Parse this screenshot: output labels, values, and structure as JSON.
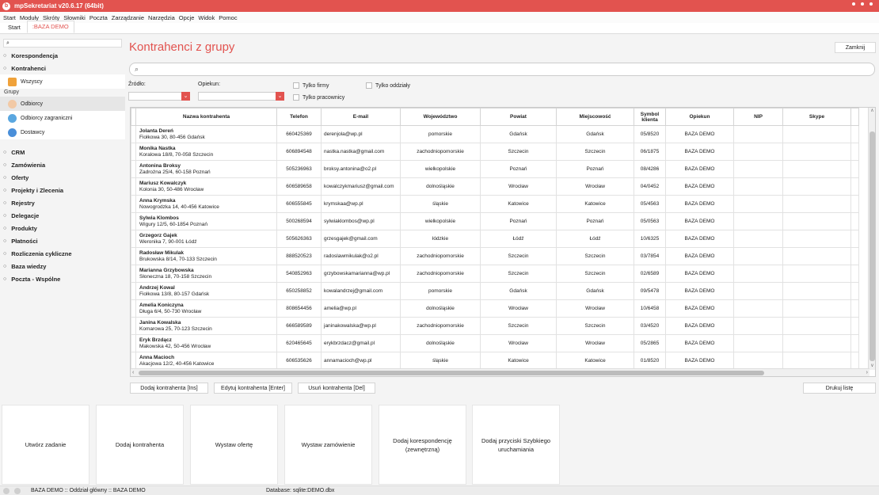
{
  "window": {
    "title": "mpSekretariat v20.6.17 (64bit)"
  },
  "menu": [
    "Start",
    "Moduły",
    "Skróty",
    "Słowniki",
    "Poczta",
    "Zarządzanie",
    "Narzędzia",
    "Opcje",
    "Widok",
    "Pomoc"
  ],
  "tabs": {
    "start": "Start",
    "active": ":BAZA DEMO"
  },
  "sidebar": {
    "search_placeholder": "",
    "sections_top": [
      "Korespondencja",
      "Kontrahenci"
    ],
    "all_item": "Wszyscy",
    "groups_label": "Grupy",
    "groups": [
      "Odbiorcy",
      "Odbiorcy zagraniczni",
      "Dostawcy"
    ],
    "sections_bottom": [
      "CRM",
      "Zamówienia",
      "Oferty",
      "Projekty i Zlecenia",
      "Rejestry",
      "Delegacje",
      "Produkty",
      "Płatności",
      "Rozliczenia cykliczne",
      "Baza wiedzy",
      "Poczta - Wspólne"
    ]
  },
  "main": {
    "title": "Kontrahenci z grupy",
    "close_label": "Zamknij",
    "source_label": "Źródło:",
    "guardian_label": "Opiekun:",
    "only_firms": "Tylko firmy",
    "only_branches": "Tylko oddziały",
    "only_employees": "Tylko pracownicy"
  },
  "table": {
    "columns": [
      "Nazwa kontrahenta",
      "Telefon",
      "E-mail",
      "Województwo",
      "Powiat",
      "Miejscowość",
      "Symbol klienta",
      "Opiekun",
      "NIP",
      "Skype"
    ],
    "rows": [
      {
        "name": "Jolanta Dereń",
        "addr": "Fiołkowa 30, 80-456 Gdańsk",
        "phone": "660425369",
        "email": "derenjola@wp.pl",
        "region": "pomorskie",
        "county": "Gdańsk",
        "city": "Gdańsk",
        "symbol": "05/8520",
        "owner": "BAZA DEMO"
      },
      {
        "name": "Monika Nastka",
        "addr": "Koralowa 18/8, 70-058 Szczecin",
        "phone": "606894548",
        "email": "nastka.nastka@gmail.com",
        "region": "zachodniopomorskie",
        "county": "Szczecin",
        "city": "Szczecin",
        "symbol": "06/1875",
        "owner": "BAZA DEMO"
      },
      {
        "name": "Antonina Broksy",
        "addr": "Zadrożna 25/4, 60-158 Poznań",
        "phone": "505236963",
        "email": "broksy.antonina@o2.pl",
        "region": "wielkopolskie",
        "county": "Poznań",
        "city": "Poznań",
        "symbol": "08/4286",
        "owner": "BAZA DEMO"
      },
      {
        "name": "Mariusz Kowalczyk",
        "addr": "Kolonia 30, 50-486 Wrocław",
        "phone": "606589658",
        "email": "kowalczykmariusz@gmail.com",
        "region": "dolnośląskie",
        "county": "Wrocław",
        "city": "Wrocław",
        "symbol": "04/0452",
        "owner": "BAZA DEMO"
      },
      {
        "name": "Anna Krymska",
        "addr": "Nowogrodzka 14, 40-456 Katowice",
        "phone": "606555845",
        "email": "krymskaa@wp.pl",
        "region": "śląskie",
        "county": "Katowice",
        "city": "Katowice",
        "symbol": "05/4563",
        "owner": "BAZA DEMO"
      },
      {
        "name": "Sylwia Klombos",
        "addr": "Wigury 12/5, 60-1854 Poznań",
        "phone": "500268594",
        "email": "sylwiaklombos@wp.pl",
        "region": "wielkopolskie",
        "county": "Poznań",
        "city": "Poznań",
        "symbol": "05/0563",
        "owner": "BAZA DEMO"
      },
      {
        "name": "Grzegorz Gajek",
        "addr": "Weronika 7, 90-001 Łódź",
        "phone": "505626363",
        "email": "grzesgajek@gmail.com",
        "region": "łódzkie",
        "county": "Łódź",
        "city": "Łódź",
        "symbol": "10/6325",
        "owner": "BAZA DEMO"
      },
      {
        "name": "Radosław Mikulak",
        "addr": "Brukowska 8/14, 70-133 Szczecin",
        "phone": "888520523",
        "email": "radoslawmikulak@o2.pl",
        "region": "zachodniopomorskie",
        "county": "Szczecin",
        "city": "Szczecin",
        "symbol": "03/7854",
        "owner": "BAZA DEMO"
      },
      {
        "name": "Marianna Grzybowska",
        "addr": "Słoneczna 18, 70-158 Szczecin",
        "phone": "540852963",
        "email": "grzybowskamarianna@wp.pl",
        "region": "zachodniopomorskie",
        "county": "Szczecin",
        "city": "Szczecin",
        "symbol": "02/6589",
        "owner": "BAZA DEMO"
      },
      {
        "name": "Andrzej Kowal",
        "addr": "Fiołkowa 13/8, 80-157 Gdańsk",
        "phone": "650258852",
        "email": "kowalandrzej@gmail.com",
        "region": "pomorskie",
        "county": "Gdańsk",
        "city": "Gdańsk",
        "symbol": "09/5478",
        "owner": "BAZA DEMO"
      },
      {
        "name": "Amelia Koniczyna",
        "addr": "Długa 6/4, 50-730 Wrocław",
        "phone": "808654456",
        "email": "amelia@wp.pl",
        "region": "dolnośląskie",
        "county": "Wrocław",
        "city": "Wrocław",
        "symbol": "10/6458",
        "owner": "BAZA DEMO"
      },
      {
        "name": "Janina Kowalska",
        "addr": "Komarowa 25, 70-123 Szczecin",
        "phone": "666589589",
        "email": "janinakowalska@wp.pl",
        "region": "zachodniopomorskie",
        "county": "Szczecin",
        "city": "Szczecin",
        "symbol": "03/4520",
        "owner": "BAZA DEMO"
      },
      {
        "name": "Eryk Brzdącz",
        "addr": "Makowska 42, 50-456 Wrocław",
        "phone": "620465645",
        "email": "erykbrzdacz@gmail.pl",
        "region": "dolnośląskie",
        "county": "Wrocław",
        "city": "Wrocław",
        "symbol": "05/2865",
        "owner": "BAZA DEMO"
      },
      {
        "name": "Anna Macioch",
        "addr": "Akacjowa 12/2, 40-456 Katowice",
        "phone": "606535626",
        "email": "annamacioch@wp.pl",
        "region": "śląskie",
        "county": "Katowice",
        "city": "Katowice",
        "symbol": "01/8520",
        "owner": "BAZA DEMO"
      }
    ]
  },
  "actions": {
    "add": "Dodaj kontrahenta [Ins]",
    "edit": "Edytuj kontrahenta [Enter]",
    "delete": "Usuń kontrahenta [Del]",
    "print": "Drukuj listę"
  },
  "tiles": [
    "Utwórz zadanie",
    "Dodaj kontrahenta",
    "Wystaw ofertę",
    "Wystaw zamówienie",
    "Dodaj korespondencję (zewnętrzną)",
    "Dodaj przyciski Szybkiego uruchamiania"
  ],
  "status": {
    "left": "BAZA DEMO :: Oddział główny :: BAZA DEMO",
    "db": "Database: sqlite:DEMO.dbx"
  },
  "colors": {
    "accent": "#e2534f"
  }
}
